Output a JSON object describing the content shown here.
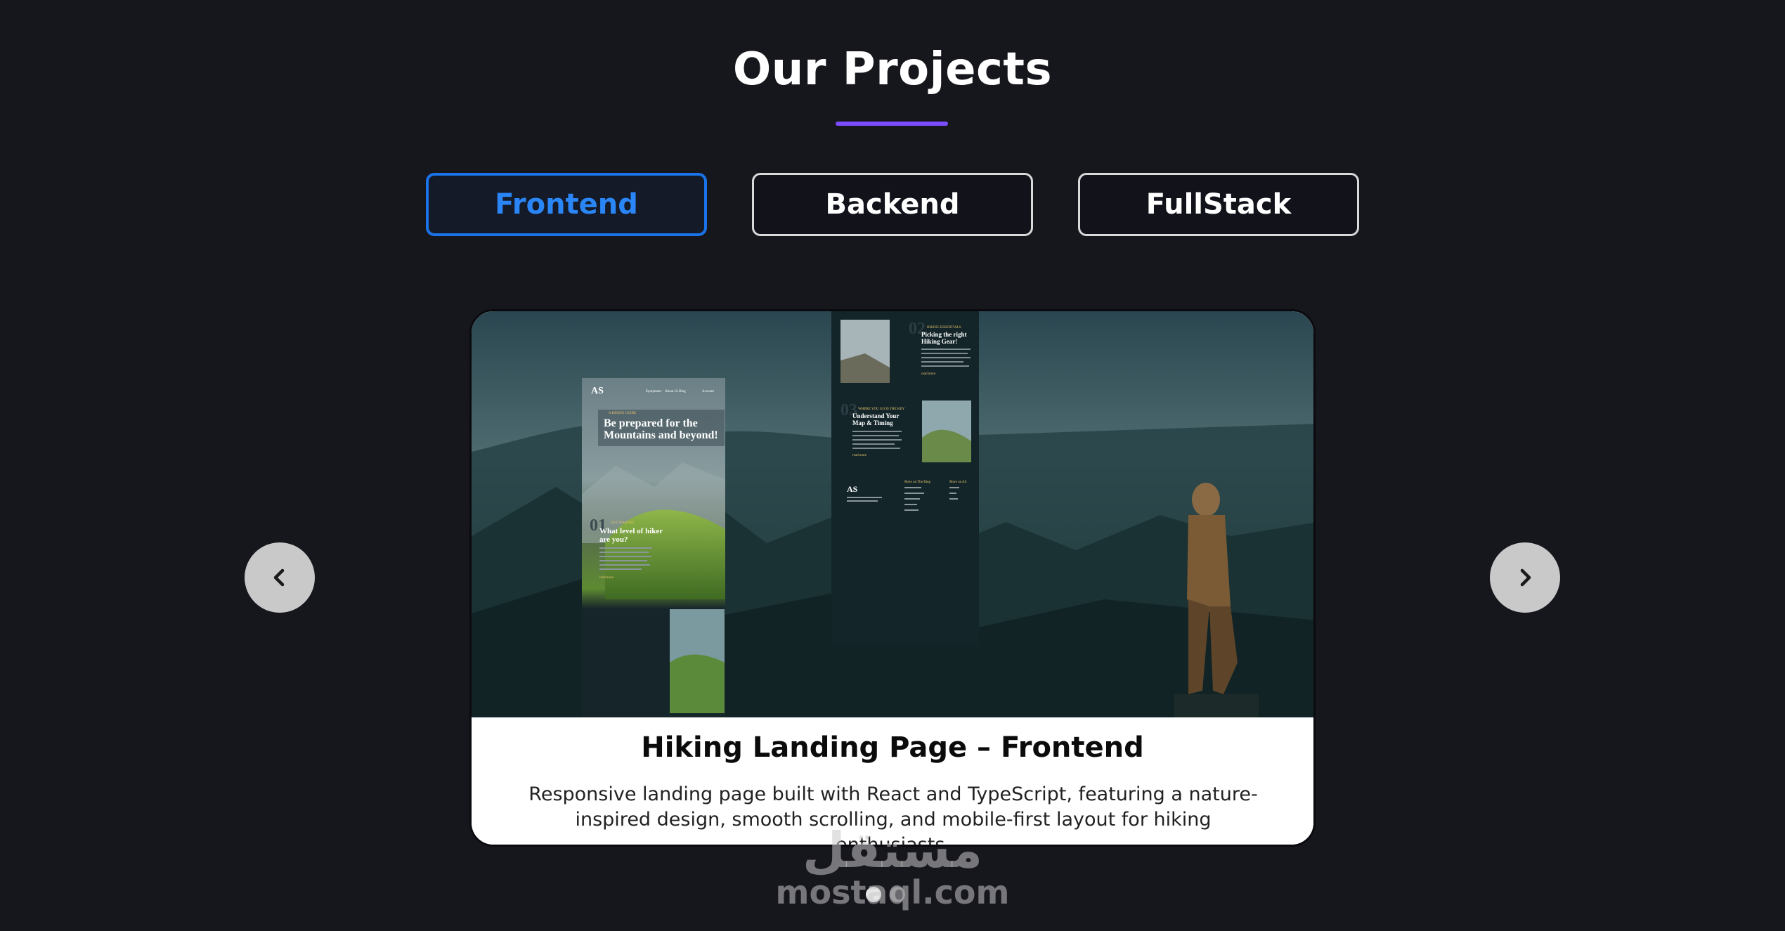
{
  "section": {
    "title": "Our Projects"
  },
  "tabs": [
    {
      "label": "Frontend",
      "active": true
    },
    {
      "label": "Backend",
      "active": false
    },
    {
      "label": "FullStack",
      "active": false
    }
  ],
  "project": {
    "title": "Hiking Landing Page – Frontend",
    "description": "Responsive landing page built with React and TypeScript, featuring a nature-inspired design, smooth scrolling, and mobile-first layout for hiking enthusiasts.",
    "preview": {
      "logo": "AS",
      "nav": [
        "Equipment",
        "About Us",
        "Blog"
      ],
      "account": "Account",
      "eyebrow": "A HIKING GUIDE",
      "headline_1": "Be prepared for the",
      "headline_2": "Mountains and beyond!",
      "step1_num": "01",
      "step1_eyebrow": "GET STARTED",
      "step1_title_1": "What level of hiker",
      "step1_title_2": "are you?",
      "step2_num": "02",
      "step2_eyebrow": "HIKING ESSENTIALS",
      "step2_title_1": "Picking the right",
      "step2_title_2": "Hiking Gear!",
      "step3_num": "03",
      "step3_eyebrow": "WHERE YOU GO IS THE KEY",
      "step3_title_1": "Understand Your",
      "step3_title_2": "Map & Timing",
      "read_more": "read more",
      "footer_blog": "More on The Blog",
      "footer_as": "More on AS"
    }
  },
  "carousel": {
    "prev_icon": "chevron-left-icon",
    "next_icon": "chevron-right-icon",
    "slides": 2,
    "active_slide": 1
  },
  "watermark": {
    "arabic": "مستقل",
    "latin": "mostaql.com"
  },
  "colors": {
    "background": "#16161d",
    "accent": "#7c4dff",
    "active_tab": "#1a73e8"
  }
}
